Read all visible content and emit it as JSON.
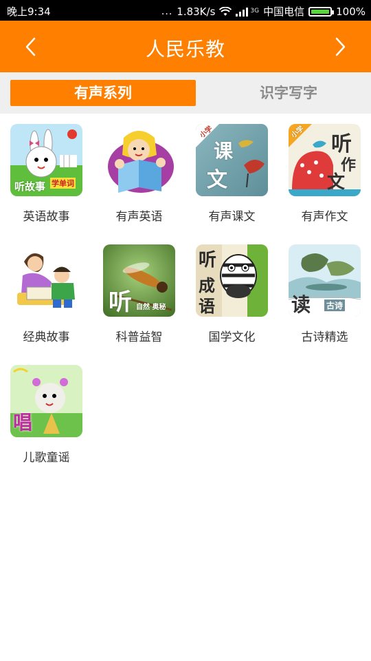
{
  "status": {
    "time": "晚上9:34",
    "dots": "...",
    "speed": "1.83K/s",
    "net": "3G",
    "carrier": "中国电信",
    "battery": "100%"
  },
  "header": {
    "title": "人民乐教",
    "back_icon": "chevron-left-icon",
    "forward_icon": "chevron-right-icon",
    "bg": "#ff7f00"
  },
  "tabs": [
    {
      "label": "有声系列",
      "active": true
    },
    {
      "label": "识字写字",
      "active": false
    }
  ],
  "items": [
    {
      "label": "英语故事",
      "icon_text": [
        "听故事",
        "学单词"
      ]
    },
    {
      "label": "有声英语",
      "icon_text": []
    },
    {
      "label": "有声课文",
      "icon_text": [
        "小学",
        "课",
        "文"
      ]
    },
    {
      "label": "有声作文",
      "icon_text": [
        "小学",
        "听",
        "作",
        "文"
      ]
    },
    {
      "label": "经典故事",
      "icon_text": []
    },
    {
      "label": "科普益智",
      "icon_text": [
        "听",
        "自然 奥秘"
      ]
    },
    {
      "label": "国学文化",
      "icon_text": [
        "听",
        "成",
        "语"
      ]
    },
    {
      "label": "古诗精选",
      "icon_text": [
        "读",
        "古诗"
      ]
    },
    {
      "label": "儿歌童谣",
      "icon_text": [
        "唱"
      ]
    }
  ]
}
